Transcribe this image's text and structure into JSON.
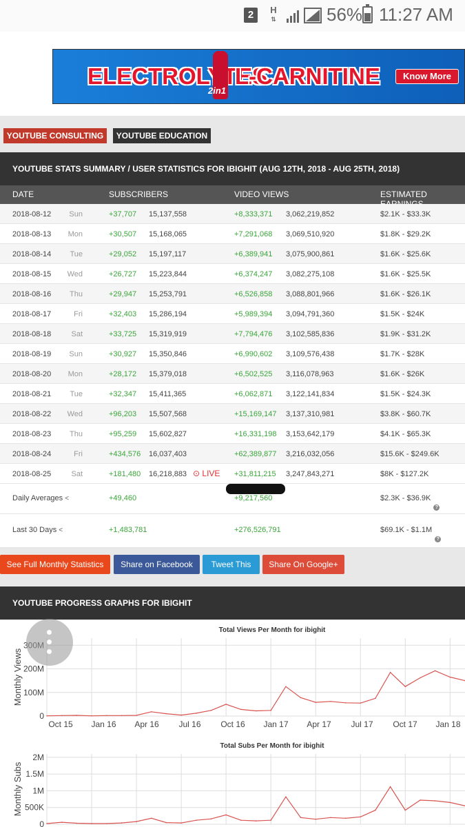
{
  "statusbar": {
    "sim": "2",
    "net": "H",
    "battery": "56%",
    "time": "11:27 AM"
  },
  "ad": {
    "word1": "ELECTROLYTES",
    "word2": "L-CARNITINE",
    "tag": "2in1",
    "button": "Know More"
  },
  "tabs": {
    "consulting": "YOUTUBE CONSULTING",
    "education": "YOUTUBE EDUCATION"
  },
  "summary": {
    "title": "YOUTUBE STATS SUMMARY / USER STATISTICS FOR IBIGHIT (AUG 12TH, 2018 - AUG 25TH, 2018)",
    "columns": [
      "DATE",
      "SUBSCRIBERS",
      "VIDEO VIEWS",
      "ESTIMATED EARNINGS"
    ],
    "rows": [
      {
        "date": "2018-08-12",
        "day": "Sun",
        "sub_delta": "+37,707",
        "sub_total": "15,137,558",
        "view_delta": "+8,333,371",
        "view_total": "3,062,219,852",
        "earn": "$2.1K  -  $33.3K"
      },
      {
        "date": "2018-08-13",
        "day": "Mon",
        "sub_delta": "+30,507",
        "sub_total": "15,168,065",
        "view_delta": "+7,291,068",
        "view_total": "3,069,510,920",
        "earn": "$1.8K  -  $29.2K"
      },
      {
        "date": "2018-08-14",
        "day": "Tue",
        "sub_delta": "+29,052",
        "sub_total": "15,197,117",
        "view_delta": "+6,389,941",
        "view_total": "3,075,900,861",
        "earn": "$1.6K  -  $25.6K"
      },
      {
        "date": "2018-08-15",
        "day": "Wed",
        "sub_delta": "+26,727",
        "sub_total": "15,223,844",
        "view_delta": "+6,374,247",
        "view_total": "3,082,275,108",
        "earn": "$1.6K  -  $25.5K"
      },
      {
        "date": "2018-08-16",
        "day": "Thu",
        "sub_delta": "+29,947",
        "sub_total": "15,253,791",
        "view_delta": "+6,526,858",
        "view_total": "3,088,801,966",
        "earn": "$1.6K  -  $26.1K"
      },
      {
        "date": "2018-08-17",
        "day": "Fri",
        "sub_delta": "+32,403",
        "sub_total": "15,286,194",
        "view_delta": "+5,989,394",
        "view_total": "3,094,791,360",
        "earn": "$1.5K  -  $24K"
      },
      {
        "date": "2018-08-18",
        "day": "Sat",
        "sub_delta": "+33,725",
        "sub_total": "15,319,919",
        "view_delta": "+7,794,476",
        "view_total": "3,102,585,836",
        "earn": "$1.9K  -  $31.2K"
      },
      {
        "date": "2018-08-19",
        "day": "Sun",
        "sub_delta": "+30,927",
        "sub_total": "15,350,846",
        "view_delta": "+6,990,602",
        "view_total": "3,109,576,438",
        "earn": "$1.7K  -  $28K"
      },
      {
        "date": "2018-08-20",
        "day": "Mon",
        "sub_delta": "+28,172",
        "sub_total": "15,379,018",
        "view_delta": "+6,502,525",
        "view_total": "3,116,078,963",
        "earn": "$1.6K  -  $26K"
      },
      {
        "date": "2018-08-21",
        "day": "Tue",
        "sub_delta": "+32,347",
        "sub_total": "15,411,365",
        "view_delta": "+6,062,871",
        "view_total": "3,122,141,834",
        "earn": "$1.5K  -  $24.3K"
      },
      {
        "date": "2018-08-22",
        "day": "Wed",
        "sub_delta": "+96,203",
        "sub_total": "15,507,568",
        "view_delta": "+15,169,147",
        "view_total": "3,137,310,981",
        "earn": "$3.8K  -  $60.7K"
      },
      {
        "date": "2018-08-23",
        "day": "Thu",
        "sub_delta": "+95,259",
        "sub_total": "15,602,827",
        "view_delta": "+16,331,198",
        "view_total": "3,153,642,179",
        "earn": "$4.1K  -  $65.3K"
      },
      {
        "date": "2018-08-24",
        "day": "Fri",
        "sub_delta": "+434,576",
        "sub_total": "16,037,403",
        "view_delta": "+62,389,877",
        "view_total": "3,216,032,056",
        "earn": "$15.6K  -  $249.6K"
      },
      {
        "date": "2018-08-25",
        "day": "Sat",
        "sub_delta": "+181,480",
        "sub_total": "16,218,883",
        "view_delta": "+31,811,215",
        "view_total": "3,247,843,271",
        "earn": "$8K  -  $127.2K",
        "live": "LIVE"
      }
    ],
    "daily_avg": {
      "label": "Daily Averages",
      "subs": "+49,460",
      "views": "+9,217,560",
      "earn": "$2.3K  -  $36.9K"
    },
    "last30": {
      "label": "Last 30 Days",
      "subs": "+1,483,781",
      "views": "+276,526,791",
      "earn": "$69.1K  -  $1.1M"
    }
  },
  "share": {
    "monthly": "See Full Monthly Statistics",
    "facebook": "Share on Facebook",
    "tweet": "Tweet This",
    "google": "Share On Google+"
  },
  "graphs_title": "YOUTUBE PROGRESS GRAPHS FOR IBIGHIT",
  "chart_data": [
    {
      "type": "line",
      "title": "Total Views Per Month for ibighit",
      "ylabel": "Monthly Views",
      "xlabel": "",
      "x_ticks": [
        "Oct 15",
        "Jan 16",
        "Apr 16",
        "Jul 16",
        "Oct 16",
        "Jan 17",
        "Apr 17",
        "Jul 17",
        "Oct 17",
        "Jan 18"
      ],
      "y_ticks": [
        "0",
        "100M",
        "200M",
        "300M"
      ],
      "ylim": [
        0,
        330
      ],
      "color": "#d9534f",
      "values": [
        1,
        2,
        3,
        1,
        2,
        2,
        3,
        18,
        10,
        4,
        12,
        24,
        50,
        28,
        22,
        24,
        125,
        78,
        58,
        62,
        56,
        55,
        75,
        185,
        125,
        162,
        192,
        165,
        150
      ]
    },
    {
      "type": "line",
      "title": "Total Subs Per Month for ibighit",
      "ylabel": "Monthly Subs",
      "xlabel": "",
      "y_ticks": [
        "0",
        "500K",
        "1M",
        "1.5M",
        "2M"
      ],
      "ylim": [
        0,
        2.1
      ],
      "color": "#d9534f",
      "values": [
        0.02,
        0.06,
        0.03,
        0.02,
        0.02,
        0.04,
        0.08,
        0.18,
        0.05,
        0.04,
        0.12,
        0.16,
        0.28,
        0.12,
        0.1,
        0.12,
        0.82,
        0.2,
        0.15,
        0.2,
        0.18,
        0.22,
        0.42,
        1.12,
        0.42,
        0.72,
        0.7,
        0.65,
        0.55
      ]
    }
  ]
}
